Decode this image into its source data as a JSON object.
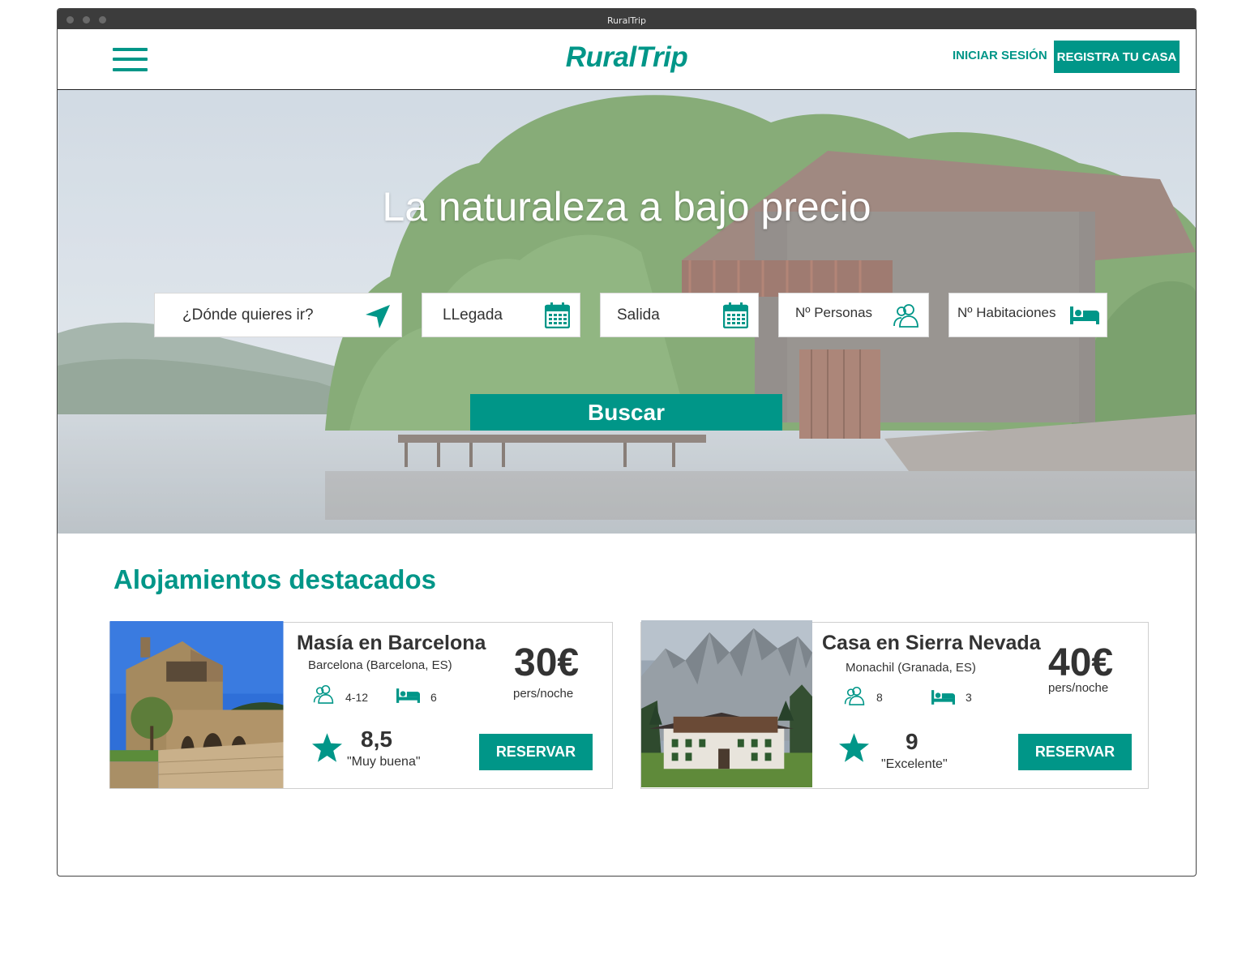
{
  "window": {
    "title": "RuralTrip"
  },
  "header": {
    "logo": "RuralTrip",
    "login_label": "INICIAR SESIÓN",
    "register_label": "REGISTRA TU CASA"
  },
  "hero": {
    "title": "La naturaleza a bajo precio",
    "search": {
      "destination_placeholder": "¿Dónde quieres ir?",
      "arrival_placeholder": "LLegada",
      "departure_placeholder": "Salida",
      "people_placeholder": "Nº Personas",
      "rooms_placeholder": "Nº Habitaciones",
      "button_label": "Buscar"
    }
  },
  "featured": {
    "title": "Alojamientos destacados",
    "listings": [
      {
        "name": "Masía en Barcelona",
        "location": "Barcelona (Barcelona, ES)",
        "price": "30€",
        "price_unit": "pers/noche",
        "guests": "4-12",
        "beds": "6",
        "rating": "8,5",
        "rating_label": "\"Muy buena\"",
        "book_label": "RESERVAR"
      },
      {
        "name": "Casa en Sierra Nevada",
        "location": "Monachil (Granada, ES)",
        "price": "40€",
        "price_unit": "pers/noche",
        "guests": "8",
        "beds": "3",
        "rating": "9",
        "rating_label": "\"Excelente\"",
        "book_label": "RESERVAR"
      }
    ]
  },
  "colors": {
    "accent": "#009688",
    "text": "#333333",
    "titlebar": "#3c3c3c"
  },
  "icons": [
    "menu-icon",
    "location-arrow-icon",
    "calendar-icon",
    "people-icon",
    "bed-icon",
    "star-icon"
  ]
}
